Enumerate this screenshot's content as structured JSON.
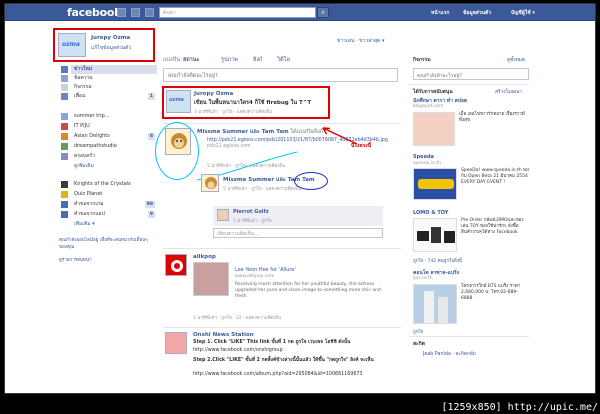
{
  "topbar": {
    "logo": "facebook",
    "search_placeholder": "ค้นหา",
    "search_icon": "magnifier-icon",
    "links": [
      "หน้าแรก",
      "ข้อมูลส่วนตัว",
      "บัญชีผู้ใช้ ▾"
    ]
  },
  "profile": {
    "name": "Juropy Ozma",
    "edit_label": "แก้ไขข้อมูลส่วนตัว",
    "avatar_text": "ozma"
  },
  "left_nav": {
    "main": [
      {
        "label": "ข่าวใหม่",
        "selected": true
      },
      {
        "label": "ข้อความ"
      },
      {
        "label": "กิจกรรม"
      },
      {
        "label": "เพื่อน",
        "count": "1"
      }
    ],
    "apps": [
      {
        "label": "summer trip..."
      },
      {
        "label": "IT PIJU"
      },
      {
        "label": "Asian Delights",
        "count": "8"
      },
      {
        "label": "dreampathstudio"
      },
      {
        "label": "ครอบครัว"
      },
      {
        "label": "ดูเพิ่มเติม",
        "more": true
      }
    ],
    "games": [
      {
        "label": "Knights of the Crystals"
      },
      {
        "label": "Quiz Planet"
      },
      {
        "label": "คำขอจากเกม",
        "count": "98"
      },
      {
        "label": "คำขอจากแอป",
        "count": "9"
      },
      {
        "label": "เพิ่มเติม ▾",
        "more": true
      }
    ],
    "footer1": "คุณกำลังออนไลน์อยู่ เพื่อที่จะสนทนากับเพื่อนๆ ของคุณ",
    "footer2": "ดูรายการสนทนา"
  },
  "center": {
    "share_label": "แบ่งปัน:",
    "share_items": [
      "สถานะ",
      "รูปภาพ",
      "ลิงก์",
      "วิดีโอ"
    ],
    "sort_label": "ข่าวเด่น · ข่าวล่าสุด ▾",
    "status_placeholder": "คุณกำลังคิดอะไรอยู่?",
    "highlight_post": {
      "name": "Juropy Ozma",
      "text": "เขียน ในพื้นหนานาใคร4 ก็ใช้ firebug ใน T^T",
      "meta": "3 นาทีที่แล้ว · ถูกใจ · แสดงความคิดเห็น"
    },
    "arrow_label": "นี่ไงตรงนี้",
    "post2": {
      "name": "Missme Summer และ Tam Tam",
      "name_suffix": " ได้แบ่งปันลิงก์",
      "link": "http://pds21.egloos.com/pds/201103/21/87/b0079087_4d871eb4d3b4b.jpg",
      "link_domain": "pds21.egloos.com",
      "meta": "5 นาทีที่แล้ว · ถูกใจ · แสดงความคิดเห็น"
    },
    "post3": {
      "name": "Missme Summer และ Tam Tam",
      "meta": "5 นาทีที่แล้ว · ถูกใจ · แสดงความคิดเห็น"
    },
    "comment": {
      "name": "Pierrot Golfz",
      "meta": "1 นาทีที่แล้ว · ถูกใจ",
      "input_placeholder": "เขียนความคิดเห็น..."
    },
    "post4": {
      "name": "allkpop",
      "title": "Lee Yeon Hee for 'Allure'",
      "url": "www.allkpop.com",
      "desc": "Receiving much attention for her youthful beauty, the actress upgraded her pure and clean image to something more chic and fresh.",
      "meta": "1 นาทีที่แล้ว · ถูกใจ · 32 · แสดงความคิดเห็น"
    },
    "post5": {
      "name": "Onshi News Station",
      "step1": "Step 1. Click \"LIKE\" This link ขั้นที่ 1 กด ถูกใจ เวบเพจ โอชิชิ ดังนั้น",
      "step1_url": "http://www.facebook.com/onshigroup",
      "step2": "Step 2.Click \"LIKE\" ขั้นที่ 2 กดลิ้งค์ข้างล่างนี้นั้นแล้ว ให้ขึ้น \"กดถูกใจ\" ลิงค์ จะเห็น",
      "step2_url": "http://www.facebook.com/album.php?aid=295084&id=100661169673"
    }
  },
  "right": {
    "events_head": "กิจกรรม",
    "events_link": "ดูทั้งหมด",
    "events_search": "คุณกำลังทำอะไรอยู่?",
    "sponsored_head": "ได้รับการสนับสนุน",
    "sponsored_link": "สร้างโฆษณา",
    "ad1": {
      "title": "นักศึกษา ดารา ทำ สปอต",
      "url": "blogspot.com",
      "text": "เมื่อ เธอไข่ขาวรักทลาย เรื่องราวมีทั้งสุข"
    },
    "ad2": {
      "title": "Speeda",
      "url": "speeda.in.th",
      "text": "SpeeDa! www.speeda.in.th พบกับ Open Beta 21 มีนาคม 2554 EVERY DAY EVENT !"
    },
    "ad3": {
      "title": "LOMO & TOY",
      "url": "",
      "text": "Pre Order กล้องLOMOและของเล่น TOY ของใช้น่ารักๆ สั่งซื้อสินค้าง่ายๆได้ทาง Facebook"
    },
    "ad3_like": "ถูกใจ · 742 คนถูกใจสิ่งนี้",
    "ad4": {
      "title": "คอนโด ลาซาล-แบริ่ง",
      "url": "lpn.co.th",
      "text": "โครงการใกล้ BTS แบริ่ง ราคา 2,680,000 บ. โทร.02-689-6888"
    },
    "ad4_like": "ถูกใจ",
    "chat_head": "สะกิด",
    "chat_item": "Jeab Panida · สะกิดกลับ"
  },
  "watermark": "[1259x850] http://upic.me/"
}
